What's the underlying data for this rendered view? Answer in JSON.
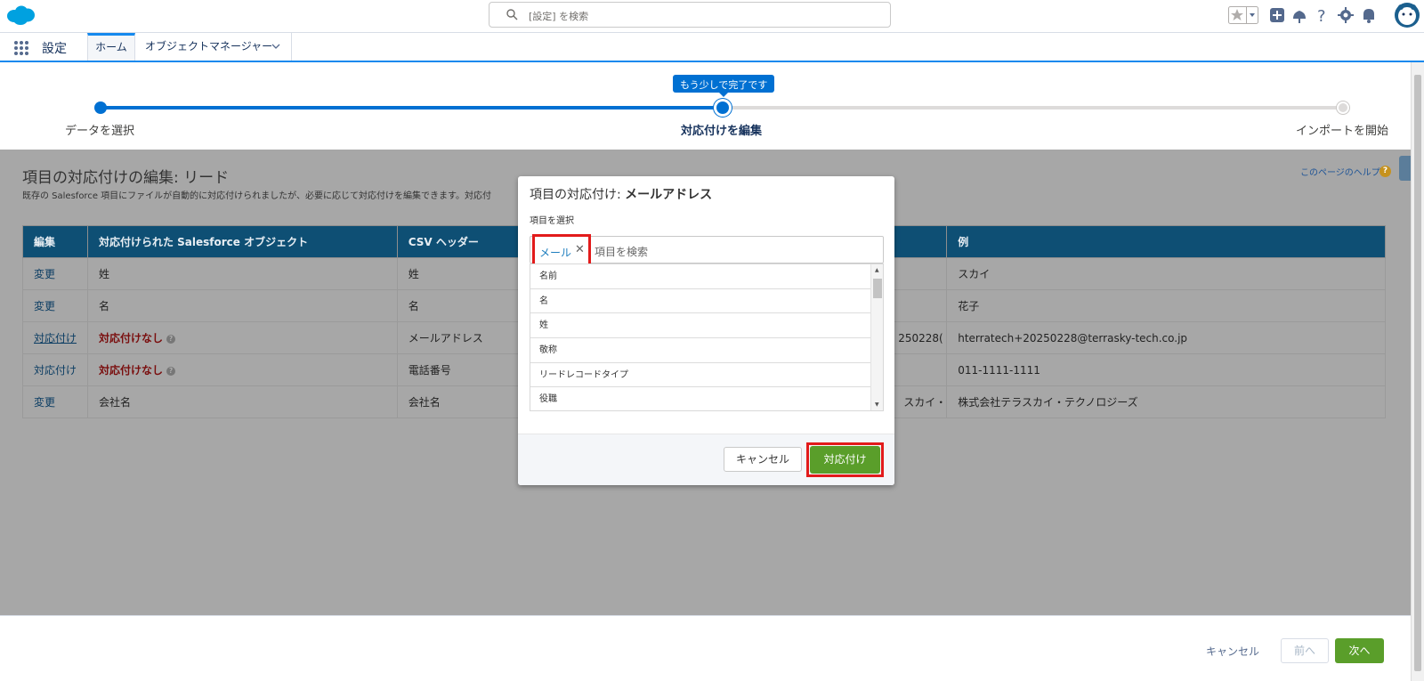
{
  "header": {
    "search_placeholder": "[設定] を検索"
  },
  "nav": {
    "app_name": "設定",
    "tabs": [
      {
        "label": "ホーム"
      },
      {
        "label": "オブジェクトマネージャー"
      }
    ]
  },
  "progress": {
    "badge": "もう少しで完了です",
    "steps": [
      {
        "label": "データを選択"
      },
      {
        "label": "対応付けを編集"
      },
      {
        "label": "インポートを開始"
      }
    ],
    "current_step": 2,
    "completion": 0.5
  },
  "page": {
    "title": "項目の対応付けの編集: リード",
    "description": "既存の Salesforce 項目にファイルが自動的に対応付けられましたが、必要に応じて対応付けを編集できます。対応付",
    "help_link": "このページのヘルプ",
    "help_icon": "?"
  },
  "table": {
    "headers": [
      "編集",
      "対応付けられた Salesforce オブジェクト",
      "CSV ヘッダー",
      "",
      "例"
    ],
    "rows": [
      {
        "action": "変更",
        "object": "姓",
        "csv": "姓",
        "col4": "",
        "example": "スカイ"
      },
      {
        "action": "変更",
        "object": "名",
        "csv": "名",
        "col4": "",
        "example": "花子"
      },
      {
        "action": "対応付け",
        "object": "対応付けなし",
        "csv": "メールアドレス",
        "col4": "250228(",
        "example": "hterratech+20250228@terrasky-tech.co.jp"
      },
      {
        "action": "対応付け",
        "object": "対応付けなし",
        "csv": "電話番号",
        "col4": "",
        "example": "011-1111-1111"
      },
      {
        "action": "変更",
        "object": "会社名",
        "csv": "会社名",
        "col4": "スカイ・",
        "example": "株式会社テラスカイ・テクノロジーズ"
      }
    ]
  },
  "modal": {
    "title_prefix": "項目の対応付け: ",
    "title_field": "メールアドレス",
    "select_label": "項目を選択",
    "selected_pill": "メール",
    "pill_remove": "✕",
    "search_placeholder": "項目を検索",
    "items": [
      "名前",
      "名",
      "姓",
      "敬称",
      "リードレコードタイプ",
      "役職"
    ],
    "cancel": "キャンセル",
    "confirm": "対応付け"
  },
  "footer": {
    "cancel": "キャンセル",
    "prev": "前へ",
    "next": "次へ"
  },
  "colors": {
    "brand_blue": "#0070d2",
    "table_header": "#0e4f74",
    "green_button": "#5a9e2a",
    "highlight_red": "#e21b1b"
  }
}
